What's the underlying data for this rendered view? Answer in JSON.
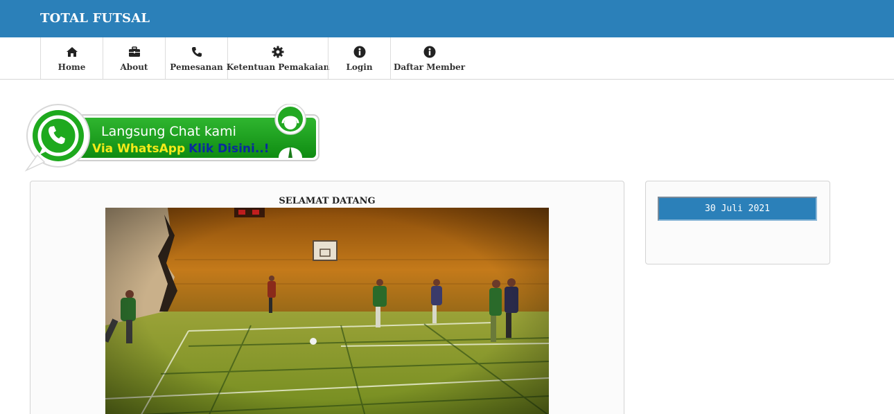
{
  "header": {
    "brand": "TOTAL FUTSAL",
    "bg_color": "#2b80b9"
  },
  "nav": {
    "items": [
      {
        "label": "Home",
        "icon": "home-icon"
      },
      {
        "label": "About",
        "icon": "briefcase-icon"
      },
      {
        "label": "Pemesanan",
        "icon": "phone-icon"
      },
      {
        "label": "Ketentuan Pemakaian",
        "icon": "gear-icon"
      },
      {
        "label": "Login",
        "icon": "info-icon"
      },
      {
        "label": "Daftar Member",
        "icon": "info-icon"
      }
    ]
  },
  "whatsapp_banner": {
    "line1": "Langsung Chat kami",
    "line2a": "Via WhatsApp",
    "line2b": "Klik Disini..!",
    "color": "#1fa31f"
  },
  "main": {
    "heading": "SELAMAT DATANG",
    "image": "futsal-match-photo"
  },
  "sidebar": {
    "date": "30 Juli 2021",
    "date_bg": "#2b80b9"
  }
}
